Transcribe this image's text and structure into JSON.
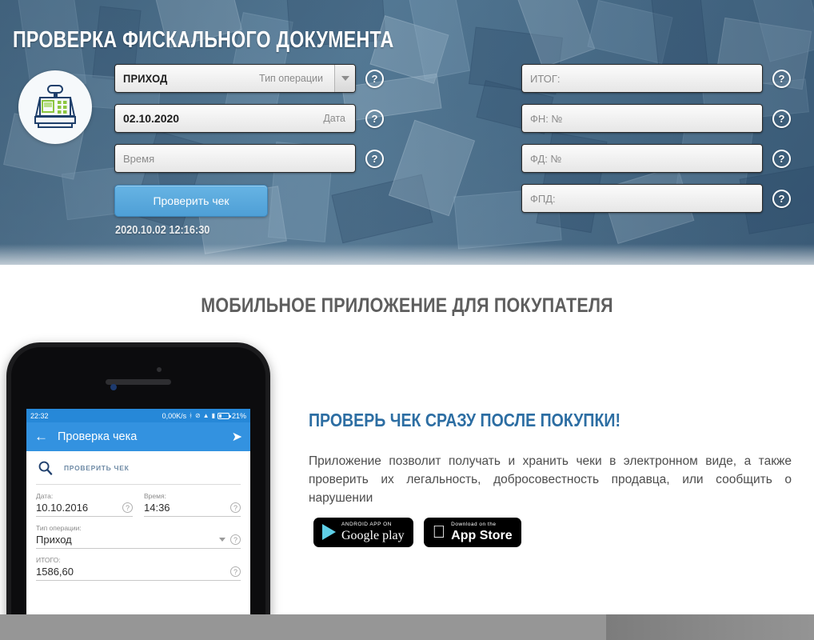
{
  "header": {
    "title": "ПРОВЕРКА ФИСКАЛЬНОГО ДОКУМЕНТА",
    "register_icon": "cash-register-icon",
    "help_symbol": "?",
    "left_fields": [
      {
        "name": "operation-type",
        "value": "ПРИХОД",
        "label": "Тип операции",
        "has_dropdown": true
      },
      {
        "name": "date",
        "value": "02.10.2020",
        "label": "Дата",
        "has_dropdown": false
      },
      {
        "name": "time",
        "placeholder": "Время",
        "label": "",
        "has_dropdown": false
      }
    ],
    "right_fields": [
      {
        "name": "total",
        "placeholder": "ИТОГ:"
      },
      {
        "name": "fn-number",
        "placeholder": "ФН: №"
      },
      {
        "name": "fd-number",
        "placeholder": "ФД: №"
      },
      {
        "name": "fpd",
        "placeholder": "ФПД:"
      }
    ],
    "submit_label": "Проверить чек",
    "timestamp": "2020.10.02 12:16:30"
  },
  "promo": {
    "section_title": "МОБИЛЬНОЕ ПРИЛОЖЕНИЕ ДЛЯ ПОКУПАТЕЛЯ",
    "headline": "ПРОВЕРЬ ЧЕК СРАЗУ ПОСЛЕ ПОКУПКИ!",
    "description": "Приложение позволит получать и хранить чеки в электронном виде, а также проверить их легальность, добросовестность продавца, или сообщить о нарушении",
    "badges": [
      {
        "name": "google-play",
        "top": "ANDROID APP ON",
        "bottom": "Google play"
      },
      {
        "name": "app-store",
        "top": "Download on the",
        "bottom": "App Store"
      }
    ]
  },
  "phone": {
    "statusbar": {
      "time": "22:32",
      "speed": "0,00K/s",
      "battery": "21%",
      "icons": [
        "bluetooth-icon",
        "mute-icon",
        "wifi-icon",
        "signal-icon",
        "battery-icon"
      ]
    },
    "appbar": {
      "back": "←",
      "title": "Проверка чека",
      "send": "➤"
    },
    "search": {
      "icon": "search-icon",
      "label": "ПРОВЕРИТЬ ЧЕК"
    },
    "fields": {
      "date_label": "Дата:",
      "date_value": "10.10.2016",
      "time_label": "Время:",
      "time_value": "14:36",
      "optype_label": "Тип операции:",
      "optype_value": "Приход",
      "total_label": "ИТОГО:",
      "total_value": "1586,60",
      "help_symbol": "?"
    }
  },
  "colors": {
    "header_blue": "#5a7f99",
    "button_blue": "#4e9fd6",
    "headline_blue": "#2d6ea3",
    "appbar_blue": "#3392e0",
    "bottom_gray": "#969696"
  }
}
